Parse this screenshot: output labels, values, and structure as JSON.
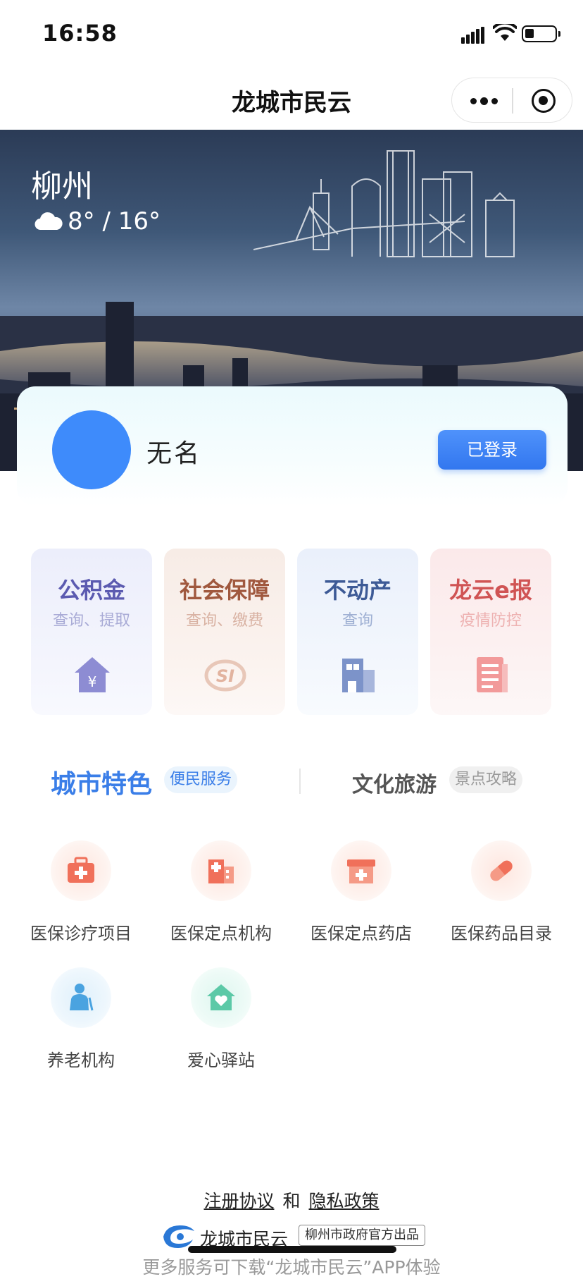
{
  "status_bar": {
    "time": "16:58"
  },
  "header": {
    "title": "龙城市民云"
  },
  "banner": {
    "city": "柳州",
    "temp": "8° / 16°"
  },
  "user": {
    "name": "无名",
    "login_button": "已登录"
  },
  "service_cards": [
    {
      "title": "公积金",
      "subtitle": "查询、提取",
      "icon": "house-yuan-icon",
      "color": "#5b5ab0"
    },
    {
      "title": "社会保障",
      "subtitle": "查询、缴费",
      "icon": "si-logo-icon",
      "color": "#a0583e"
    },
    {
      "title": "不动产",
      "subtitle": "查询",
      "icon": "building-icon",
      "color": "#3d5a96"
    },
    {
      "title": "龙云e报",
      "subtitle": "疫情防控",
      "icon": "document-icon",
      "color": "#d05454"
    }
  ],
  "tabs": {
    "left": {
      "title": "城市特色",
      "tag": "便民服务"
    },
    "right": {
      "title": "文化旅游",
      "tag": "景点攻略"
    }
  },
  "services": [
    {
      "label": "医保诊疗项目",
      "icon": "medical-kit-icon"
    },
    {
      "label": "医保定点机构",
      "icon": "hospital-icon"
    },
    {
      "label": "医保定点药店",
      "icon": "pharmacy-icon"
    },
    {
      "label": "医保药品目录",
      "icon": "pill-icon"
    },
    {
      "label": "养老机构",
      "icon": "elderly-icon"
    },
    {
      "label": "爱心驿站",
      "icon": "heart-house-icon"
    }
  ],
  "footer": {
    "link_register": "注册协议",
    "link_and": "和",
    "link_privacy": "隐私政策",
    "logo_name": "龙城市民云",
    "logo_tag": "柳州市政府官方出品",
    "download_text": "更多服务可下载“龙城市民云”APP体验"
  }
}
